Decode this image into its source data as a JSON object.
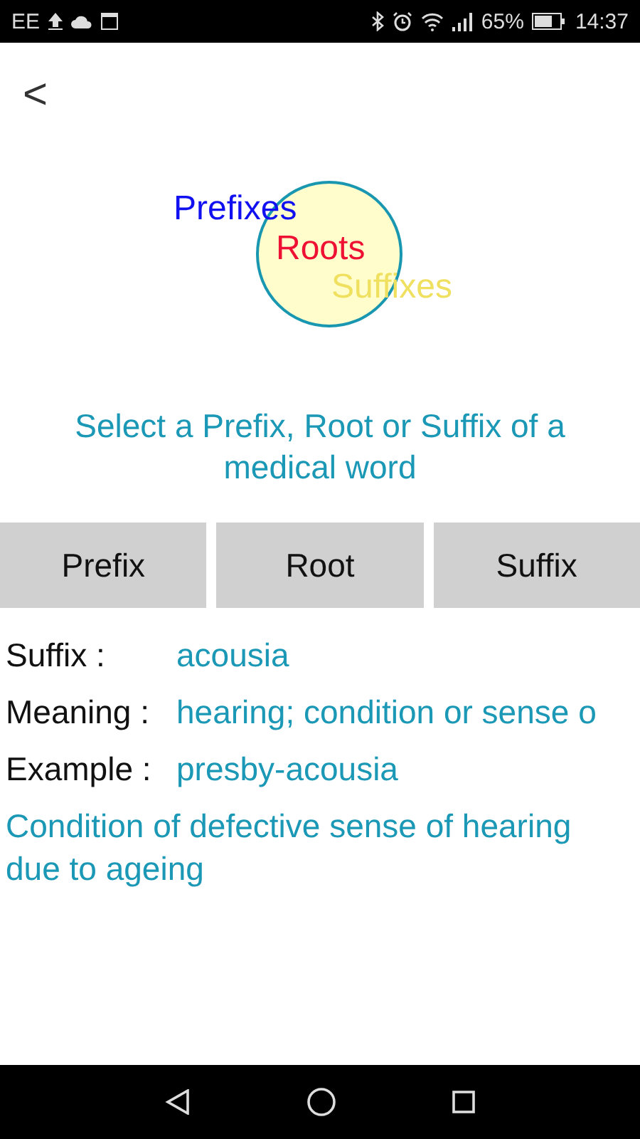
{
  "status_bar": {
    "carrier": "EE",
    "battery": "65%",
    "time": "14:37"
  },
  "back": "<",
  "logo": {
    "words": [
      "Prefixes",
      "Roots",
      "Suffixes"
    ]
  },
  "instruction": "Select a Prefix, Root or Suffix of a medical word",
  "buttons": [
    "Prefix",
    "Root",
    "Suffix"
  ],
  "details": [
    {
      "label": "Suffix :",
      "value": "acousia"
    },
    {
      "label": "Meaning :",
      "value": "hearing; condition or sense o"
    },
    {
      "label": "Example :",
      "value": "presby-acousia"
    }
  ],
  "description": "Condition of defective sense of hearing due to ageing"
}
